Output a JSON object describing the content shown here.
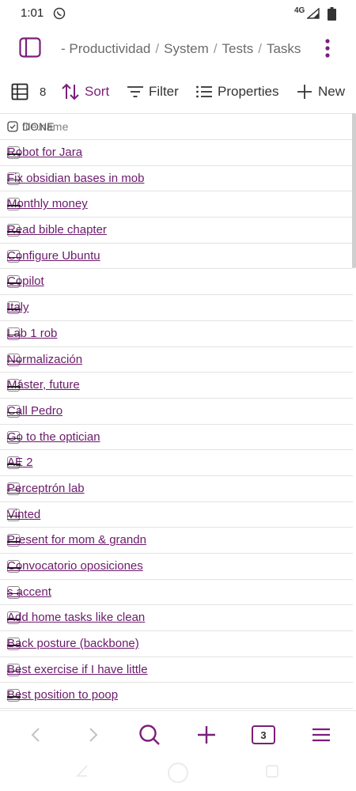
{
  "status": {
    "time": "1:01",
    "network": "4G"
  },
  "breadcrumb": [
    "- Productividad",
    "System",
    "Tests",
    "Tasks"
  ],
  "toolbar": {
    "count": "8",
    "sort": "Sort",
    "filter": "Filter",
    "properties": "Properties",
    "new": "New"
  },
  "table": {
    "col_done": "DONE",
    "col_name": "file.name",
    "rows": [
      "Robot for Jara",
      "Fix obsidian bases in mob",
      "Monthly money",
      "Read bible chapter",
      "Configure Ubuntu",
      "Copilot",
      "Italy",
      "Lab 1 rob",
      "Normalización",
      "Máster, future",
      "Call Pedro",
      "Go to the optician",
      "AE 2",
      "Perceptrón lab",
      "Vinted",
      "Present for mom & grandn",
      "Convocatorio oposiciones",
      "s accent",
      "Add home tasks like clean",
      "Back posture (backbone)",
      "Best exercise if I have little",
      "Best position to poop"
    ]
  },
  "bottom_nav": {
    "tabs_count": "3"
  },
  "colors": {
    "accent": "#7a1f7a",
    "link": "#6b1a6b"
  }
}
